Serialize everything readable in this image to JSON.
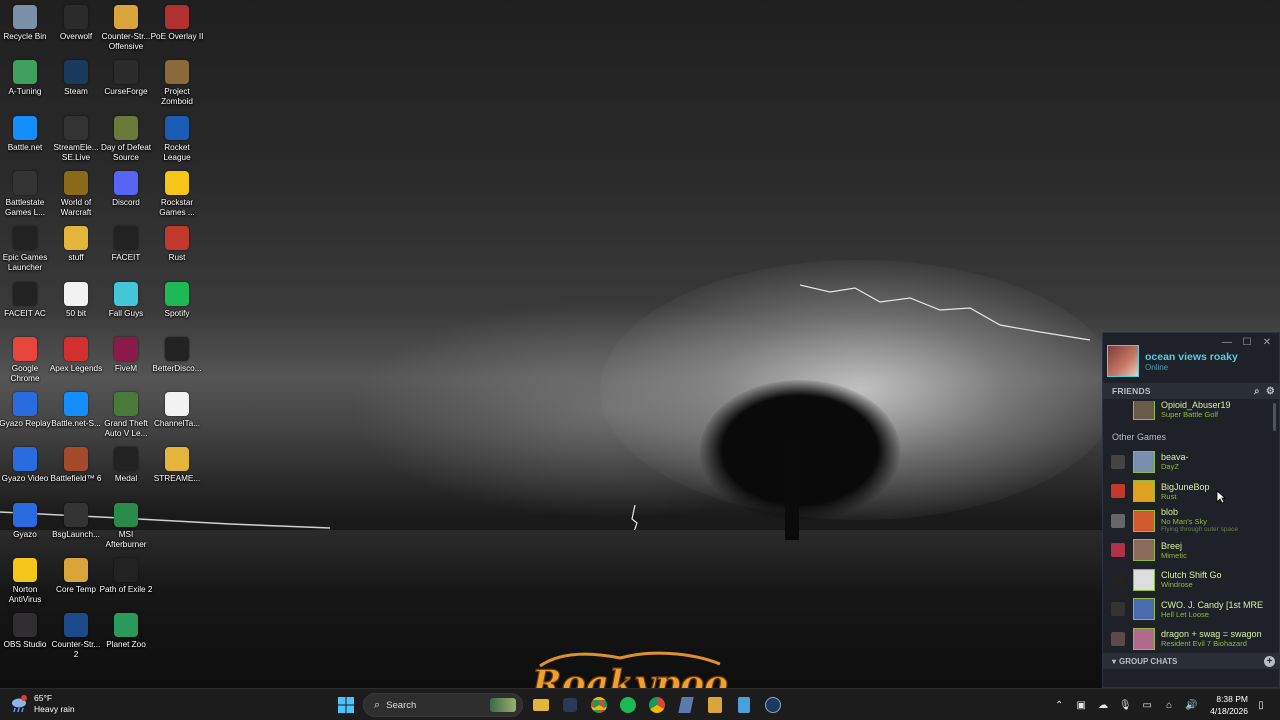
{
  "desktop": {
    "icons": [
      {
        "label": "Recycle Bin",
        "icon": "recycle-bin-icon",
        "color": "#7a8fa8"
      },
      {
        "label": "Overwolf",
        "icon": "overwolf-icon",
        "color": "#2b2b2b"
      },
      {
        "label": "Counter-Str... Offensive",
        "icon": "counter-strike-icon",
        "color": "#d9a43a"
      },
      {
        "label": "PoE Overlay II",
        "icon": "poe-overlay-icon",
        "color": "#b33030"
      },
      {
        "label": "A-Tuning",
        "icon": "a-tuning-icon",
        "color": "#3f9f5f"
      },
      {
        "label": "Steam",
        "icon": "steam-icon",
        "color": "#1b3a5f"
      },
      {
        "label": "CurseForge",
        "icon": "curseforge-icon",
        "color": "#2b2b2b"
      },
      {
        "label": "Project Zomboid",
        "icon": "project-zomboid-icon",
        "color": "#8a6a3a"
      },
      {
        "label": "Battle.net",
        "icon": "battlenet-icon",
        "color": "#148eff"
      },
      {
        "label": "StreamEle... SE.Live",
        "icon": "streamelements-icon",
        "color": "#333"
      },
      {
        "label": "Day of Defeat Source",
        "icon": "day-of-defeat-icon",
        "color": "#6b7a3a"
      },
      {
        "label": "Rocket League",
        "icon": "rocket-league-icon",
        "color": "#1a5bb5"
      },
      {
        "label": "Battlestate Games L...",
        "icon": "battlestate-icon",
        "color": "#333"
      },
      {
        "label": "World of Warcraft",
        "icon": "world-of-warcraft-icon",
        "color": "#8a6a1a"
      },
      {
        "label": "Discord",
        "icon": "discord-icon",
        "color": "#5865f2"
      },
      {
        "label": "Rockstar Games ...",
        "icon": "rockstar-icon",
        "color": "#f5c518"
      },
      {
        "label": "Epic Games Launcher",
        "icon": "epic-games-icon",
        "color": "#222"
      },
      {
        "label": "stuff",
        "icon": "folder-icon",
        "color": "#e5b53b"
      },
      {
        "label": "FACEIT",
        "icon": "faceit-icon",
        "color": "#222"
      },
      {
        "label": "Rust",
        "icon": "rust-icon",
        "color": "#c0392b"
      },
      {
        "label": "FACEIT AC",
        "icon": "faceit-ac-icon",
        "color": "#222"
      },
      {
        "label": "50 bit",
        "icon": "document-icon",
        "color": "#f2f2f2"
      },
      {
        "label": "Fall Guys",
        "icon": "fall-guys-icon",
        "color": "#42c6d8"
      },
      {
        "label": "Spotify",
        "icon": "spotify-icon",
        "color": "#1db954"
      },
      {
        "label": "Google Chrome",
        "icon": "chrome-icon",
        "color": "#e8453c"
      },
      {
        "label": "Apex Legends",
        "icon": "apex-legends-icon",
        "color": "#d32f2f"
      },
      {
        "label": "FiveM",
        "icon": "fivem-icon",
        "color": "#8a1a4a"
      },
      {
        "label": "BetterDisco...",
        "icon": "betterdiscord-icon",
        "color": "#222"
      },
      {
        "label": "Gyazo Replay",
        "icon": "gyazo-replay-icon",
        "color": "#2b6be0"
      },
      {
        "label": "Battle.net-S...",
        "icon": "battlenet-shortcut-icon",
        "color": "#148eff"
      },
      {
        "label": "Grand Theft Auto V Le...",
        "icon": "gta-v-icon",
        "color": "#4a7a3a"
      },
      {
        "label": "ChannelTa...",
        "icon": "channeltalk-icon",
        "color": "#f2f2f2"
      },
      {
        "label": "Gyazo Video",
        "icon": "gyazo-video-icon",
        "color": "#2b6be0"
      },
      {
        "label": "Battlefield™ 6",
        "icon": "battlefield-icon",
        "color": "#a34a2a"
      },
      {
        "label": "Medal",
        "icon": "medal-icon",
        "color": "#222"
      },
      {
        "label": "STREAME...",
        "icon": "folder-icon",
        "color": "#e5b53b"
      },
      {
        "label": "Gyazo",
        "icon": "gyazo-icon",
        "color": "#2b6be0"
      },
      {
        "label": "BsgLaunch...",
        "icon": "bsg-launcher-icon",
        "color": "#333"
      },
      {
        "label": "MSI Afterburner",
        "icon": "msi-afterburner-icon",
        "color": "#2a8a4a"
      },
      {
        "label": "",
        "icon": "",
        "color": ""
      },
      {
        "label": "Norton AntiVirus",
        "icon": "norton-icon",
        "color": "#f5c518"
      },
      {
        "label": "Core Temp",
        "icon": "core-temp-icon",
        "color": "#d9a43a"
      },
      {
        "label": "Path of Exile 2",
        "icon": "path-of-exile-icon",
        "color": "#222"
      },
      {
        "label": "",
        "icon": "",
        "color": ""
      },
      {
        "label": "OBS Studio",
        "icon": "obs-studio-icon",
        "color": "#302e31"
      },
      {
        "label": "Counter-Str... 2",
        "icon": "counter-strike-2-icon",
        "color": "#1a4a8a"
      },
      {
        "label": "Planet Zoo",
        "icon": "planet-zoo-icon",
        "color": "#2a9a5a"
      }
    ]
  },
  "watermark": {
    "text": "Roakypoo"
  },
  "steam": {
    "user": {
      "name": "ocean views roaky",
      "status": "Online"
    },
    "friends_header": "FRIENDS",
    "top_friend": {
      "name": "Opioid_Abuser19",
      "game": "Super Battle Golf",
      "game_icon_color": "#5a6a7a"
    },
    "section_label": "Other Games",
    "friends": [
      {
        "name": "beava-",
        "game": "DayZ",
        "rich": "",
        "game_icon": "dayz-icon",
        "game_icon_color": "#444",
        "avatar_color": "#7a8fb0"
      },
      {
        "name": "BigJuneBop",
        "game": "Rust",
        "rich": "",
        "game_icon": "rust-icon",
        "game_icon_color": "#c0392b",
        "avatar_color": "#e0a020"
      },
      {
        "name": "blob",
        "game": "No Man's Sky",
        "rich": "Flying through outer space",
        "game_icon": "no-mans-sky-icon",
        "game_icon_color": "#666",
        "avatar_color": "#d05a2a"
      },
      {
        "name": "Breej",
        "game": "Mimetic",
        "rich": "",
        "game_icon": "mimetic-icon",
        "game_icon_color": "#b0304a",
        "avatar_color": "#8a6a5a"
      },
      {
        "name": "Clutch Shift Go",
        "game": "Windrose",
        "rich": "",
        "game_icon": "windrose-icon",
        "game_icon_color": "#222",
        "avatar_color": "#dddddd"
      },
      {
        "name": "CWO. J. Candy [1st MRE",
        "game": "Hell Let Loose",
        "rich": "",
        "game_icon": "hell-let-loose-icon",
        "game_icon_color": "#333",
        "avatar_color": "#4a6ab0"
      },
      {
        "name": "dragon + swag = swagon",
        "game": "Resident Evil 7 Biohazard",
        "rich": "",
        "game_icon": "resident-evil-icon",
        "game_icon_color": "#5a4a4a",
        "avatar_color": "#b06a8a"
      }
    ],
    "group_chats": "GROUP CHATS"
  },
  "taskbar": {
    "weather": {
      "temp": "65°F",
      "condition": "Heavy rain"
    },
    "search_placeholder": "Search",
    "time": "8:38 PM",
    "date": "4/18/2026",
    "pinned": [
      "start-icon",
      "search-icon",
      "taskview-icon",
      "file-explorer-icon",
      "game-icon",
      "chrome-icon",
      "spotify-icon",
      "chrome-icon",
      "app-icon",
      "game-icon",
      "notepad-icon",
      "steam-icon"
    ]
  }
}
